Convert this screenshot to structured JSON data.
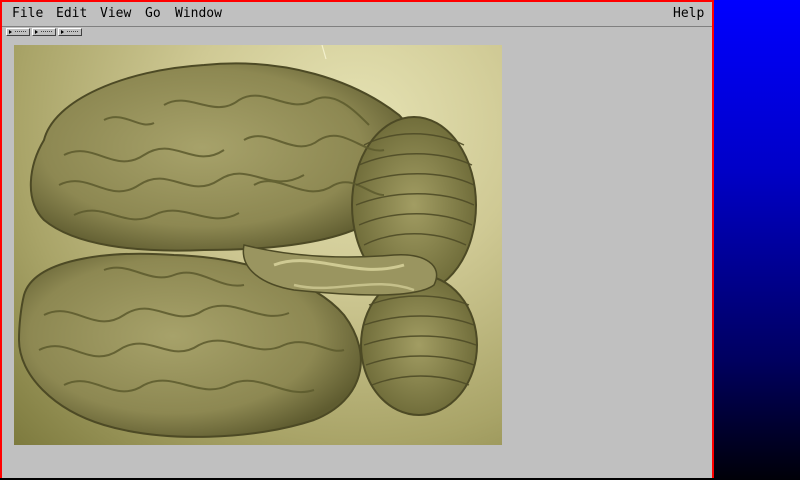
{
  "menubar": {
    "items": [
      "File",
      "Edit",
      "View",
      "Go",
      "Window"
    ],
    "help": "Help"
  },
  "toolbar": {
    "handles": [
      "handle-1",
      "handle-2",
      "handle-3"
    ]
  },
  "content": {
    "image_icon": "brain-specimen-photo"
  },
  "colors": {
    "window_border": "#ff0000",
    "chrome": "#c0c0c0",
    "desktop_top": "#0000ff",
    "desktop_bottom": "#000008",
    "specimen_tissue": "#8f8b55"
  }
}
